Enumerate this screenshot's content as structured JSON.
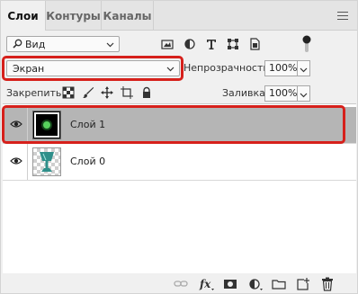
{
  "tabs": [
    {
      "label": "Слои",
      "active": true
    },
    {
      "label": "Контуры",
      "active": false
    },
    {
      "label": "Каналы",
      "active": false
    }
  ],
  "filter": {
    "value": "Вид"
  },
  "blend": {
    "mode": "Экран"
  },
  "opacity": {
    "label": "Непрозрачность:",
    "value": "100%"
  },
  "lock": {
    "label": "Закрепить:"
  },
  "fill": {
    "label": "Заливка:",
    "value": "100%"
  },
  "layers": [
    {
      "name": "Слой 1",
      "selected": true,
      "visible": true
    },
    {
      "name": "Слой 0",
      "selected": false,
      "visible": true
    }
  ],
  "colors": {
    "highlight": "#d6201b",
    "selected_row": "#b5b5b5"
  }
}
